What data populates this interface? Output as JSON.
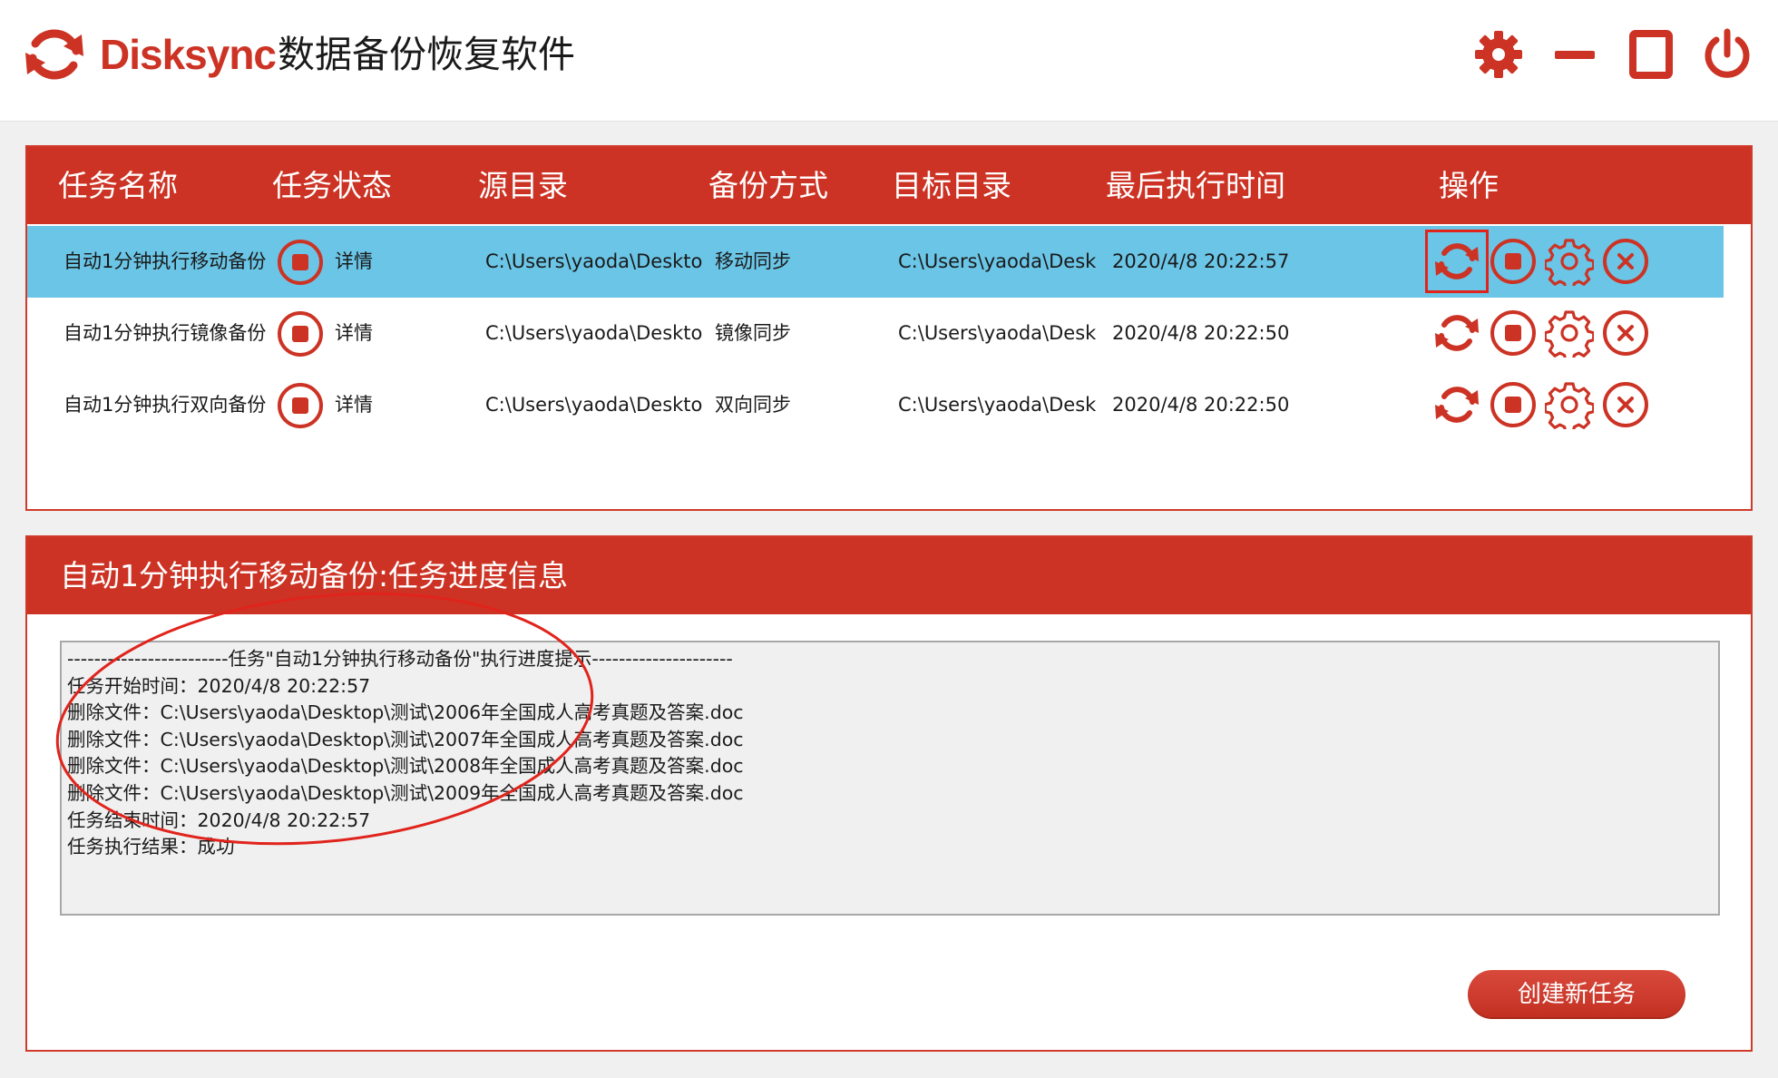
{
  "app": {
    "brand": "Disksync",
    "title": "数据备份恢复软件",
    "accent": "#cc3324",
    "selection": "#6bc5e6"
  },
  "window_controls": {
    "settings_icon": "gear-icon",
    "minimize_icon": "minimize-icon",
    "maximize_icon": "maximize-icon",
    "power_icon": "power-icon"
  },
  "table": {
    "columns": [
      "任务名称",
      "任务状态",
      "源目录",
      "备份方式",
      "目标目录",
      "最后执行时间",
      "操作"
    ],
    "rows": [
      {
        "name": "自动1分钟执行移动备份",
        "details": "详情",
        "source": "C:\\Users\\yaoda\\Deskto",
        "method": "移动同步",
        "target": "C:\\Users\\yaoda\\Desk",
        "last_run": "2020/4/8 20:22:57",
        "selected": true
      },
      {
        "name": "自动1分钟执行镜像备份",
        "details": "详情",
        "source": "C:\\Users\\yaoda\\Deskto",
        "method": "镜像同步",
        "target": "C:\\Users\\yaoda\\Desk",
        "last_run": "2020/4/8 20:22:50",
        "selected": false
      },
      {
        "name": "自动1分钟执行双向备份",
        "details": "详情",
        "source": "C:\\Users\\yaoda\\Deskto",
        "method": "双向同步",
        "target": "C:\\Users\\yaoda\\Desk",
        "last_run": "2020/4/8 20:22:50",
        "selected": false
      }
    ],
    "operation_icons": [
      "sync-icon",
      "stop-icon",
      "settings-icon",
      "delete-icon"
    ]
  },
  "progress": {
    "title": "自动1分钟执行移动备份:任务进度信息",
    "log": [
      "------------------------任务\"自动1分钟执行移动备份\"执行进度提示---------------------",
      "任务开始时间：2020/4/8 20:22:57",
      "删除文件：C:\\Users\\yaoda\\Desktop\\测试\\2006年全国成人高考真题及答案.doc",
      "删除文件：C:\\Users\\yaoda\\Desktop\\测试\\2007年全国成人高考真题及答案.doc",
      "删除文件：C:\\Users\\yaoda\\Desktop\\测试\\2008年全国成人高考真题及答案.doc",
      "删除文件：C:\\Users\\yaoda\\Desktop\\测试\\2009年全国成人高考真题及答案.doc",
      "任务结束时间：2020/4/8 20:22:57",
      "任务执行结果：成功"
    ],
    "create_button": "创建新任务"
  }
}
